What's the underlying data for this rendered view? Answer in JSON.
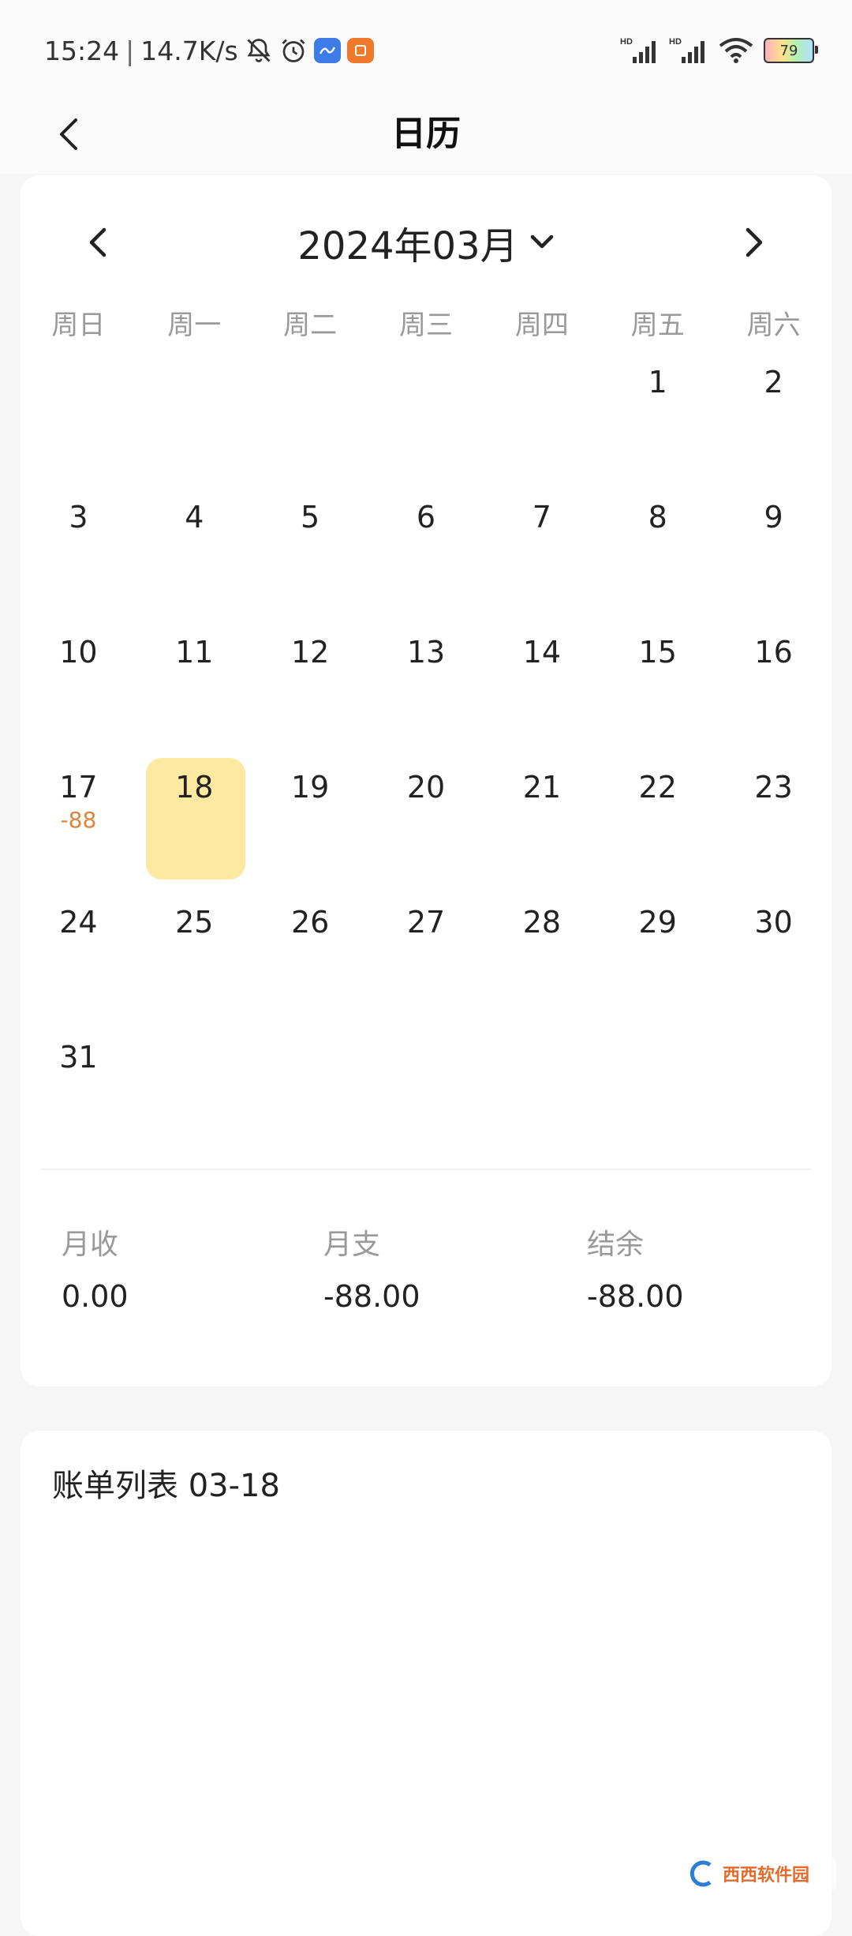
{
  "status_bar": {
    "time": "15:24",
    "network_speed": "14.7K/s",
    "battery": "79",
    "signal_1_tag": "HD",
    "signal_2_tag": "HD"
  },
  "header": {
    "title": "日历"
  },
  "calendar": {
    "month_title": "2024年03月",
    "weekdays": [
      "周日",
      "周一",
      "周二",
      "周三",
      "周四",
      "周五",
      "周六"
    ],
    "days": [
      {
        "num": ""
      },
      {
        "num": ""
      },
      {
        "num": ""
      },
      {
        "num": ""
      },
      {
        "num": ""
      },
      {
        "num": "1"
      },
      {
        "num": "2"
      },
      {
        "num": "3"
      },
      {
        "num": "4"
      },
      {
        "num": "5"
      },
      {
        "num": "6"
      },
      {
        "num": "7"
      },
      {
        "num": "8"
      },
      {
        "num": "9"
      },
      {
        "num": "10"
      },
      {
        "num": "11"
      },
      {
        "num": "12"
      },
      {
        "num": "13"
      },
      {
        "num": "14"
      },
      {
        "num": "15"
      },
      {
        "num": "16"
      },
      {
        "num": "17",
        "amount": "-88"
      },
      {
        "num": "18",
        "selected": true
      },
      {
        "num": "19"
      },
      {
        "num": "20"
      },
      {
        "num": "21"
      },
      {
        "num": "22"
      },
      {
        "num": "23"
      },
      {
        "num": "24"
      },
      {
        "num": "25"
      },
      {
        "num": "26"
      },
      {
        "num": "27"
      },
      {
        "num": "28"
      },
      {
        "num": "29"
      },
      {
        "num": "30"
      },
      {
        "num": "31"
      }
    ],
    "selected_color": "#fde9a1",
    "expense_color": "#e0823a"
  },
  "summary": {
    "income_label": "月收",
    "income_value": "0.00",
    "expense_label": "月支",
    "expense_value": "-88.00",
    "balance_label": "结余",
    "balance_value": "-88.00"
  },
  "bill_list": {
    "title": "账单列表 03-18"
  },
  "watermark": {
    "text": "西西软件园"
  }
}
